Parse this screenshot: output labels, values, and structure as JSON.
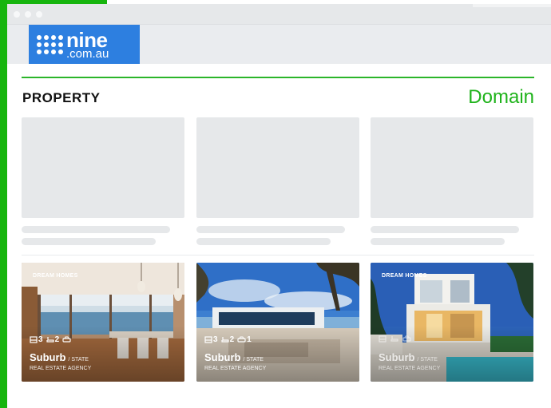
{
  "header": {
    "logo_main": "nine",
    "logo_domain": ".com.au"
  },
  "section": {
    "title": "PROPERTY",
    "brand": "Domain"
  },
  "listings": [
    {
      "badge": "DREAM HOMES",
      "beds": "3",
      "baths": "2",
      "cars": "",
      "suburb": "Suburb",
      "state": "/ STATE",
      "agency": "REAL ESTATE AGENCY"
    },
    {
      "badge": "",
      "beds": "3",
      "baths": "2",
      "cars": "1",
      "suburb": "Suburb",
      "state": "/ STATE",
      "agency": "REAL ESTATE AGENCY"
    },
    {
      "badge": "DREAM HOMES",
      "beds": "",
      "baths": "",
      "cars": "",
      "suburb": "Suburb",
      "state": "/ STATE",
      "agency": "REAL ESTATE AGENCY"
    }
  ],
  "colors": {
    "brand_green": "#17b50e",
    "nine_blue": "#2d7fe0",
    "skeleton_gray": "#e6e8ea"
  },
  "icons": [
    "bed-icon",
    "bath-icon",
    "car-icon"
  ]
}
